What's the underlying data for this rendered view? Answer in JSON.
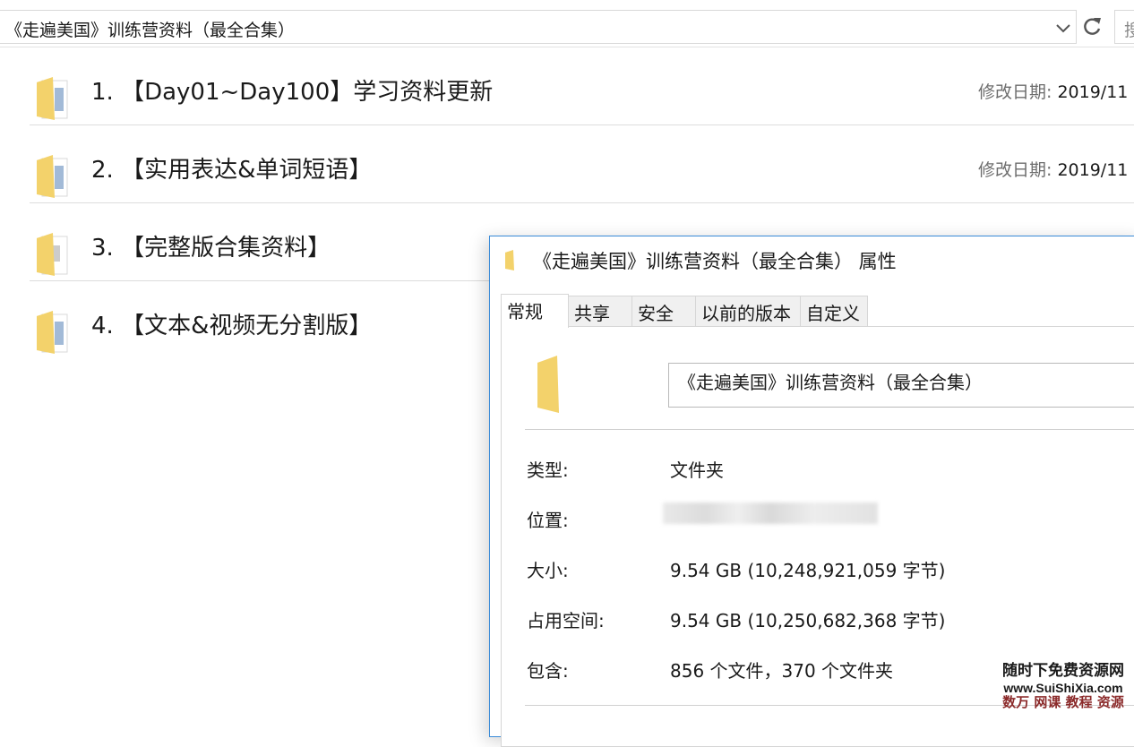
{
  "address_bar": {
    "path": "《走遍美国》训练营资料（最全合集）",
    "search_placeholder": "搜"
  },
  "icons": {
    "dropdown": "chevron-down-icon",
    "refresh": "refresh-icon",
    "folder": "folder-icon"
  },
  "files": [
    {
      "name": "1. 【Day01~Day100】学习资料更新",
      "date_label": "修改日期:",
      "date_value": "2019/11"
    },
    {
      "name": "2. 【实用表达&单词短语】",
      "date_label": "修改日期:",
      "date_value": "2019/11"
    },
    {
      "name": "3. 【完整版合集资料】",
      "date_label": "",
      "date_value": ""
    },
    {
      "name": "4. 【文本&视频无分割版】",
      "date_label": "",
      "date_value": ""
    }
  ],
  "dialog": {
    "title": "《走遍美国》训练营资料（最全合集） 属性",
    "tabs": [
      "常规",
      "共享",
      "安全",
      "以前的版本",
      "自定义"
    ],
    "active_tab": "常规",
    "folder_name": "《走遍美国》训练营资料（最全合集）",
    "properties": {
      "type_label": "类型:",
      "type_value": "文件夹",
      "location_label": "位置:",
      "size_label": "大小:",
      "size_value": "9.54 GB (10,248,921,059 字节)",
      "disk_label": "占用空间:",
      "disk_value": "9.54 GB (10,250,682,368 字节)",
      "contains_label": "包含:",
      "contains_value": "856 个文件，370 个文件夹"
    }
  },
  "watermark": {
    "line1": "随时下免费资源网",
    "line2": "www.SuiShiXia.com",
    "line3": "数万 网课 教程 资源"
  },
  "colors": {
    "accent": "#3a8bd8",
    "folder_yellow": "#f3d26b",
    "date_label": "#6d6d6d"
  }
}
